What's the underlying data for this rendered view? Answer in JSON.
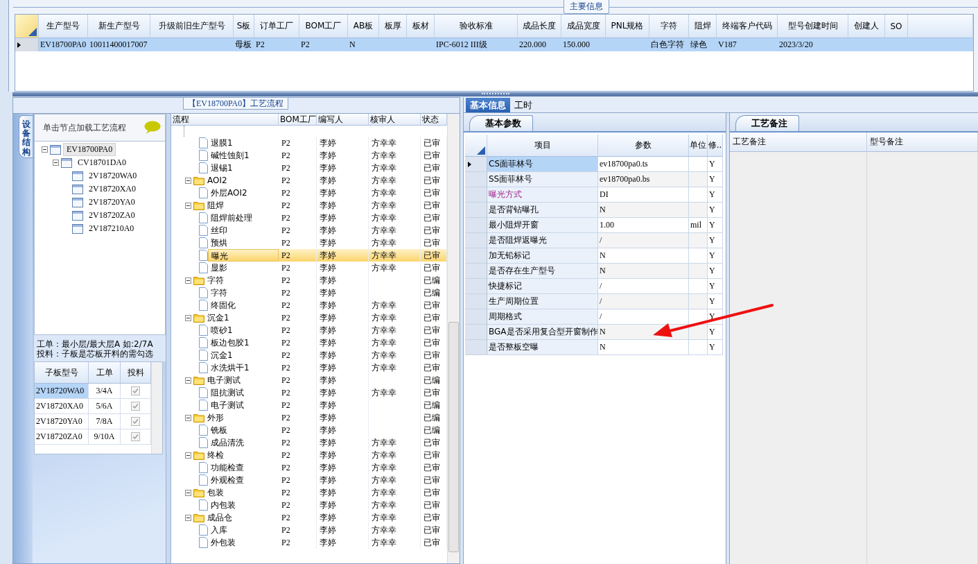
{
  "main_info": {
    "title": "主要信息",
    "columns": [
      "生产型号",
      "新生产型号",
      "升级前旧生产型号",
      "S板",
      "订单工厂",
      "BOM工厂",
      "AB板",
      "板厚",
      "板材",
      "验收标准",
      "成品长度",
      "成品宽度",
      "PNL规格",
      "字符",
      "阻焊",
      "终端客户代码",
      "型号创建时间",
      "创建人",
      "SO"
    ],
    "rows": [
      {
        "selected": true,
        "cells": [
          "EV18700PA0",
          "10011400017007",
          null,
          "母板",
          "P2",
          "P2",
          "N",
          null,
          null,
          "IPC-6012 III级",
          "220.000",
          "150.000",
          null,
          "白色字符",
          "绿色",
          "V187",
          "2023/3/20",
          null,
          null
        ]
      }
    ]
  },
  "process_panel": {
    "title": "【EV18700PA0】工艺流程",
    "side_tab": "设备结构",
    "hint": "单击节点加载工艺流程",
    "structure_tree": [
      {
        "label": "EV18700PA0",
        "selected": true,
        "expanded": true,
        "children": [
          {
            "label": "CV18701DA0",
            "selected": false,
            "expanded": true,
            "children": [
              {
                "label": "2V18720WA0",
                "selected": false
              },
              {
                "label": "2V18720XA0",
                "selected": false
              },
              {
                "label": "2V18720YA0",
                "selected": false
              },
              {
                "label": "2V18720ZA0",
                "selected": false
              },
              {
                "label": "2V187210A0",
                "selected": false
              }
            ]
          }
        ]
      }
    ],
    "notes": [
      "工单：最小层/最大层A 如:2/7A",
      "投料：子板是芯板开料的需勾选"
    ],
    "sub_boards": {
      "columns": [
        "子板型号",
        "工单",
        "投料"
      ],
      "rows": [
        {
          "model": "2V18720WA0",
          "order": "3/4A",
          "checked": true,
          "selected": true
        },
        {
          "model": "2V18720XA0",
          "order": "5/6A",
          "checked": true,
          "selected": false
        },
        {
          "model": "2V18720YA0",
          "order": "7/8A",
          "checked": true,
          "selected": false
        },
        {
          "model": "2V18720ZA0",
          "order": "9/10A",
          "checked": true,
          "selected": false
        }
      ]
    },
    "flow": {
      "columns": [
        "流程",
        "BOM工厂",
        "编写人",
        "核审人",
        "状态"
      ],
      "groups": [
        {
          "children": [
            {
              "label": "退膜1",
              "bom": "P2",
              "writer": "李婷",
              "reviewer": "方幸幸",
              "status": "已审",
              "selected": false
            },
            {
              "label": "碱性蚀刻1",
              "bom": "P2",
              "writer": "李婷",
              "reviewer": "方幸幸",
              "status": "已审",
              "selected": false
            },
            {
              "label": "退锡1",
              "bom": "P2",
              "writer": "李婷",
              "reviewer": "方幸幸",
              "status": "已审",
              "selected": false
            }
          ]
        },
        {
          "label": "AOI2",
          "bom": "P2",
          "writer": "李婷",
          "reviewer": "方幸幸",
          "status": "已审",
          "selected": false,
          "expanded": true,
          "children": [
            {
              "label": "外层AOI2",
              "bom": "P2",
              "writer": "李婷",
              "reviewer": "方幸幸",
              "status": "已审",
              "selected": false
            }
          ]
        },
        {
          "label": "阻焊",
          "bom": "P2",
          "writer": "李婷",
          "reviewer": "方幸幸",
          "status": "已审",
          "selected": false,
          "expanded": true,
          "children": [
            {
              "label": "阻焊前处理",
              "bom": "P2",
              "writer": "李婷",
              "reviewer": "方幸幸",
              "status": "已审",
              "selected": false
            },
            {
              "label": "丝印",
              "bom": "P2",
              "writer": "李婷",
              "reviewer": "方幸幸",
              "status": "已审",
              "selected": false
            },
            {
              "label": "预烘",
              "bom": "P2",
              "writer": "李婷",
              "reviewer": "方幸幸",
              "status": "已审",
              "selected": false
            },
            {
              "label": "曝光",
              "bom": "P2",
              "writer": "李婷",
              "reviewer": "方幸幸",
              "status": "已审",
              "selected": true
            },
            {
              "label": "显影",
              "bom": "P2",
              "writer": "李婷",
              "reviewer": "方幸幸",
              "status": "已审",
              "selected": false
            }
          ]
        },
        {
          "label": "字符",
          "bom": "P2",
          "writer": "李婷",
          "status": "已编",
          "selected": false,
          "expanded": true,
          "children": [
            {
              "label": "字符",
              "bom": "P2",
              "writer": "李婷",
              "status": "已编",
              "selected": false
            },
            {
              "label": "终固化",
              "bom": "P2",
              "writer": "李婷",
              "reviewer": "方幸幸",
              "status": "已审",
              "selected": false
            }
          ]
        },
        {
          "label": "沉金1",
          "bom": "P2",
          "writer": "李婷",
          "reviewer": "方幸幸",
          "status": "已审",
          "selected": false,
          "expanded": true,
          "children": [
            {
              "label": "喷砂1",
              "bom": "P2",
              "writer": "李婷",
              "reviewer": "方幸幸",
              "status": "已审",
              "selected": false
            },
            {
              "label": "板边包胶1",
              "bom": "P2",
              "writer": "李婷",
              "reviewer": "方幸幸",
              "status": "已审",
              "selected": false
            },
            {
              "label": "沉金1",
              "bom": "P2",
              "writer": "李婷",
              "reviewer": "方幸幸",
              "status": "已审",
              "selected": false
            },
            {
              "label": "水洗烘干1",
              "bom": "P2",
              "writer": "李婷",
              "reviewer": "方幸幸",
              "status": "已审",
              "selected": false
            }
          ]
        },
        {
          "label": "电子测试",
          "bom": "P2",
          "writer": "李婷",
          "status": "已编",
          "selected": false,
          "expanded": true,
          "children": [
            {
              "label": "阻抗测试",
              "bom": "P2",
              "writer": "李婷",
              "reviewer": "方幸幸",
              "status": "已审",
              "selected": false
            },
            {
              "label": "电子测试",
              "bom": "P2",
              "writer": "李婷",
              "status": "已编",
              "selected": false
            }
          ]
        },
        {
          "label": "外形",
          "bom": "P2",
          "writer": "李婷",
          "status": "已编",
          "selected": false,
          "expanded": true,
          "children": [
            {
              "label": "铣板",
              "bom": "P2",
              "writer": "李婷",
              "status": "已编",
              "selected": false
            },
            {
              "label": "成品清洗",
              "bom": "P2",
              "writer": "李婷",
              "reviewer": "方幸幸",
              "status": "已审",
              "selected": false
            }
          ]
        },
        {
          "label": "终检",
          "bom": "P2",
          "writer": "李婷",
          "reviewer": "方幸幸",
          "status": "已审",
          "selected": false,
          "expanded": true,
          "children": [
            {
              "label": "功能检查",
              "bom": "P2",
              "writer": "李婷",
              "reviewer": "方幸幸",
              "status": "已审",
              "selected": false
            },
            {
              "label": "外观检查",
              "bom": "P2",
              "writer": "李婷",
              "reviewer": "方幸幸",
              "status": "已审",
              "selected": false
            }
          ]
        },
        {
          "label": "包装",
          "bom": "P2",
          "writer": "李婷",
          "reviewer": "方幸幸",
          "status": "已审",
          "selected": false,
          "expanded": true,
          "children": [
            {
              "label": "内包装",
              "bom": "P2",
              "writer": "李婷",
              "reviewer": "方幸幸",
              "status": "已审",
              "selected": false
            }
          ]
        },
        {
          "label": "成品仓",
          "bom": "P2",
          "writer": "李婷",
          "reviewer": "方幸幸",
          "status": "已审",
          "selected": false,
          "expanded": true,
          "children": [
            {
              "label": "入库",
              "bom": "P2",
              "writer": "李婷",
              "reviewer": "方幸幸",
              "status": "已审",
              "selected": false
            },
            {
              "label": "外包装",
              "bom": "P2",
              "writer": "李婷",
              "reviewer": "方幸幸",
              "status": "已审",
              "selected": false
            }
          ]
        }
      ]
    }
  },
  "detail": {
    "tabs": [
      {
        "label": "基本信息",
        "selected": true
      },
      {
        "label": "工时",
        "selected": false
      }
    ],
    "params": {
      "tab": "基本参数",
      "columns": [
        "项目",
        "参数",
        "单位",
        "修.."
      ],
      "rows": [
        {
          "item": "CS面菲林号",
          "value": "ev18700pa0.ts",
          "mod": "Y",
          "selected": true,
          "highlighted": false
        },
        {
          "item": "SS面菲林号",
          "value": "ev18700pa0.bs",
          "mod": "Y",
          "selected": false,
          "highlighted": false
        },
        {
          "item": "曝光方式",
          "value": "DI",
          "mod": "Y",
          "selected": false,
          "highlighted": true
        },
        {
          "item": "是否背钻曝孔",
          "value": "N",
          "mod": "Y",
          "selected": false,
          "highlighted": false
        },
        {
          "item": "最小阻焊开窗",
          "value": "1.00",
          "unit": "mil",
          "mod": "Y",
          "selected": false,
          "highlighted": false
        },
        {
          "item": "是否阻焊返曝光",
          "value": "/",
          "mod": "Y",
          "selected": false,
          "highlighted": false
        },
        {
          "item": "加无铅标记",
          "value": "N",
          "mod": "Y",
          "selected": false,
          "highlighted": false
        },
        {
          "item": "是否存在生产型号",
          "value": "N",
          "mod": "Y",
          "selected": false,
          "highlighted": false
        },
        {
          "item": "快捷标记",
          "value": "/",
          "mod": "Y",
          "selected": false,
          "highlighted": false
        },
        {
          "item": "生产周期位置",
          "value": "/",
          "mod": "Y",
          "selected": false,
          "highlighted": false
        },
        {
          "item": "周期格式",
          "value": "/",
          "mod": "Y",
          "selected": false,
          "highlighted": false
        },
        {
          "item": "BGA是否采用复合型开窗制作",
          "value": "N",
          "mod": "Y",
          "selected": false,
          "highlighted": false
        },
        {
          "item": "是否整板空曝",
          "value": "N",
          "mod": "Y",
          "selected": false,
          "highlighted": false
        }
      ]
    },
    "remarks": {
      "tab": "工艺备注",
      "columns": [
        "工艺备注",
        "型号备注"
      ]
    }
  }
}
